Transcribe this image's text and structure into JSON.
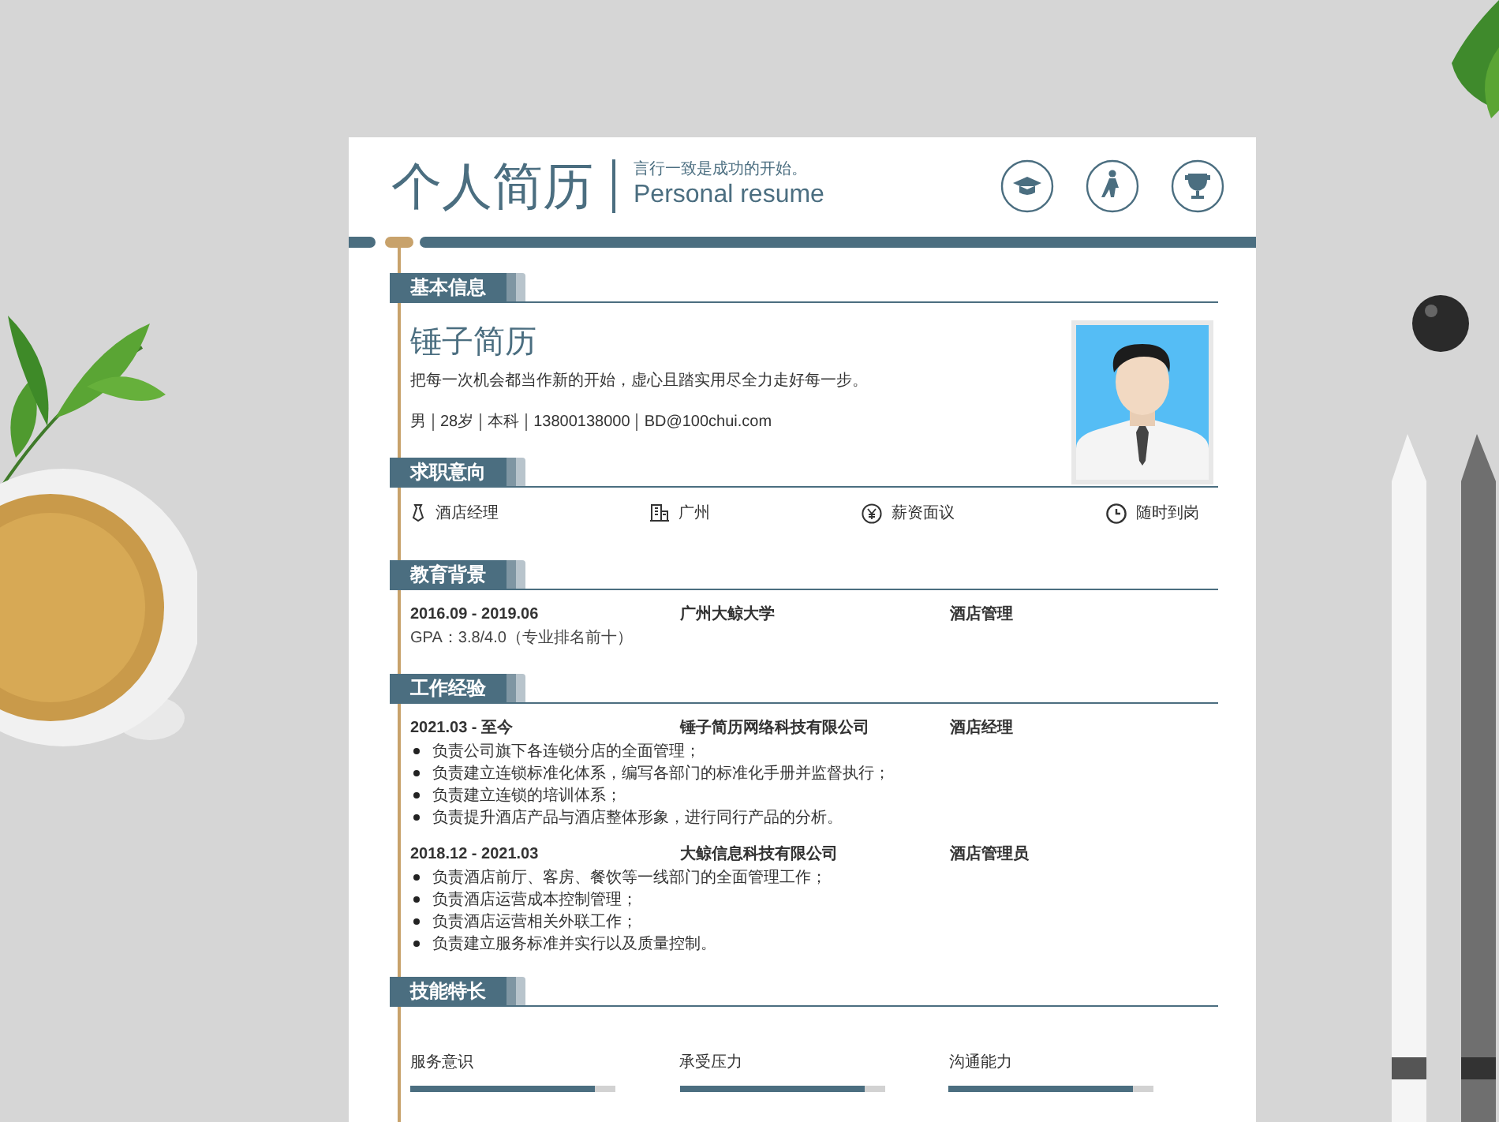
{
  "header": {
    "title": "个人简历",
    "motto": "言行一致是成功的开始。",
    "subtitle": "Personal resume"
  },
  "sections": [
    {
      "kind": "basic",
      "title": "基本信息",
      "name": "锤子简历",
      "motto": "把每一次机会都当作新的开始，虚心且踏实用尽全力走好每一步。",
      "facts": [
        "男",
        "28岁",
        "本科",
        "13800138000",
        "BD@100chui.com"
      ]
    },
    {
      "kind": "intent",
      "title": "求职意向",
      "items": [
        "酒店经理",
        "广州",
        "薪资面议",
        "随时到岗"
      ]
    },
    {
      "kind": "education",
      "title": "教育背景",
      "entries": [
        {
          "period": "2016.09 - 2019.06",
          "org": "广州大鲸大学",
          "role": "酒店管理",
          "notes": [
            "GPA：3.8/4.0（专业排名前十）"
          ]
        }
      ]
    },
    {
      "kind": "work",
      "title": "工作经验",
      "entries": [
        {
          "period": "2021.03 - 至今",
          "org": "锤子简历网络科技有限公司",
          "role": "酒店经理",
          "notes": [
            "负责公司旗下各连锁分店的全面管理；",
            "负责建立连锁标准化体系，编写各部门的标准化手册并监督执行；",
            "负责建立连锁的培训体系；",
            "负责提升酒店产品与酒店整体形象，进行同行产品的分析。"
          ]
        },
        {
          "period": "2018.12 - 2021.03",
          "org": "大鲸信息科技有限公司",
          "role": "酒店管理员",
          "notes": [
            "负责酒店前厅、客房、餐饮等一线部门的全面管理工作；",
            "负责酒店运营成本控制管理；",
            "负责酒店运营相关外联工作；",
            "负责建立服务标准并实行以及质量控制。"
          ]
        }
      ]
    },
    {
      "kind": "skills",
      "title": "技能特长",
      "skills": [
        {
          "name": "服务意识",
          "level": 0.9
        },
        {
          "name": "承受压力",
          "level": 0.9
        },
        {
          "name": "沟通能力",
          "level": 0.9
        }
      ]
    }
  ]
}
